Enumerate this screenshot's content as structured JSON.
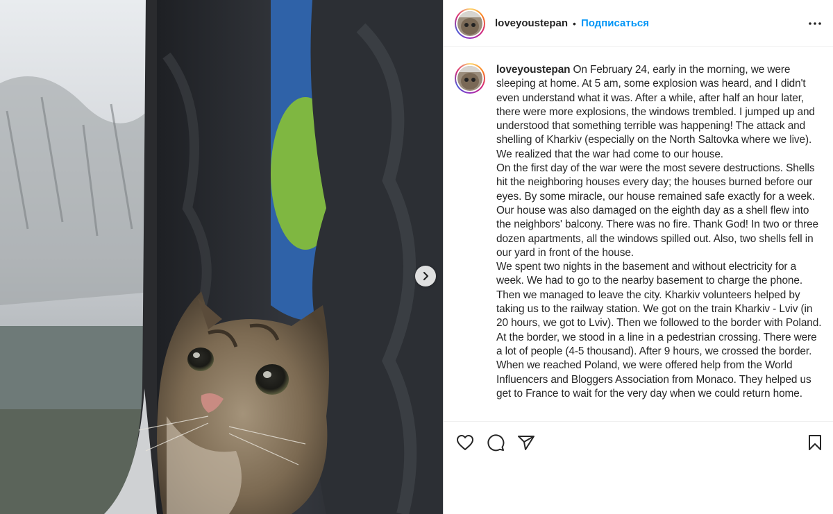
{
  "post": {
    "username": "loveyoustepan",
    "separator": "•",
    "follow_label": "Подписаться",
    "caption_user": "loveyoustepan",
    "caption_paragraphs": [
      "On February 24, early in the morning, we were sleeping at home. At 5 am, some explosion was heard, and I didn't even understand what it was. After a while, after half an hour later, there were more explosions, the windows trembled. I jumped up and understood that something terrible was happening! The attack and shelling of Kharkiv (especially on the North Saltovka where we live). We realized that the war had come to our house.",
      "On the first day of the war were the most severe destructions. Shells hit the neighboring houses every day; the houses burned before our eyes. By some miracle, our house remained safe exactly for a week. Our house was also damaged on the eighth day as a shell flew into the neighbors' balcony. There was no fire. Thank God! In two or three dozen apartments, all the windows spilled out. Also, two shells fell in our yard in front of the house.",
      "We spent two nights in the basement and without electricity for a week. We had to go to the nearby basement to charge the phone. Then we managed to leave the city. Kharkiv volunteers helped by taking us to the railway station. We got on the train Kharkiv - Lviv (in 20 hours, we got to Lviv). Then we followed to the border with Poland. At the border, we stood in a line in a pedestrian crossing. There were a lot of people (4-5 thousand). After 9 hours, we crossed the border.",
      "When we reached Poland, we were offered help from the World Influencers and Bloggers Association from Monaco. They helped us get to France to wait for the very day when we could return home."
    ]
  },
  "icons": {
    "more": "more-options-icon",
    "next": "chevron-right-icon",
    "like": "heart-icon",
    "comment": "comment-icon",
    "share": "paper-plane-icon",
    "save": "bookmark-icon"
  },
  "colors": {
    "link": "#0095f6",
    "text": "#262626",
    "border": "#dbdbdb"
  }
}
